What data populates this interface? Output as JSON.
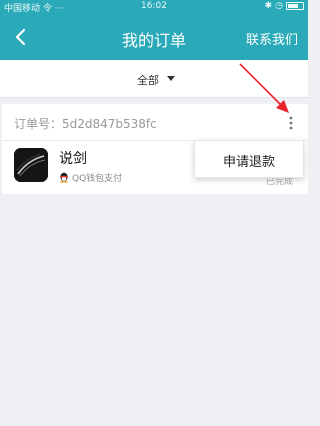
{
  "status_bar": {
    "carrier": "中国移动 令 ···",
    "time": "16:02",
    "icons": [
      "bluetooth-icon",
      "alarm-icon",
      "battery-icon"
    ]
  },
  "header": {
    "title": "我的订单",
    "contact_label": "联系我们",
    "back_icon": "chevron-left-icon"
  },
  "filter": {
    "selected": "全部",
    "caret_icon": "caret-down-icon"
  },
  "order": {
    "order_number": "订单号：5d2d847b538fc",
    "app_name": "说剑",
    "payment_method": "QQ钱包支付",
    "status": "已完成",
    "more_icon": "more-vertical-icon"
  },
  "menu": {
    "refund_label": "申请退款"
  },
  "colors": {
    "brand": "#2aa9b8",
    "annotation_arrow": "#e8232b"
  }
}
